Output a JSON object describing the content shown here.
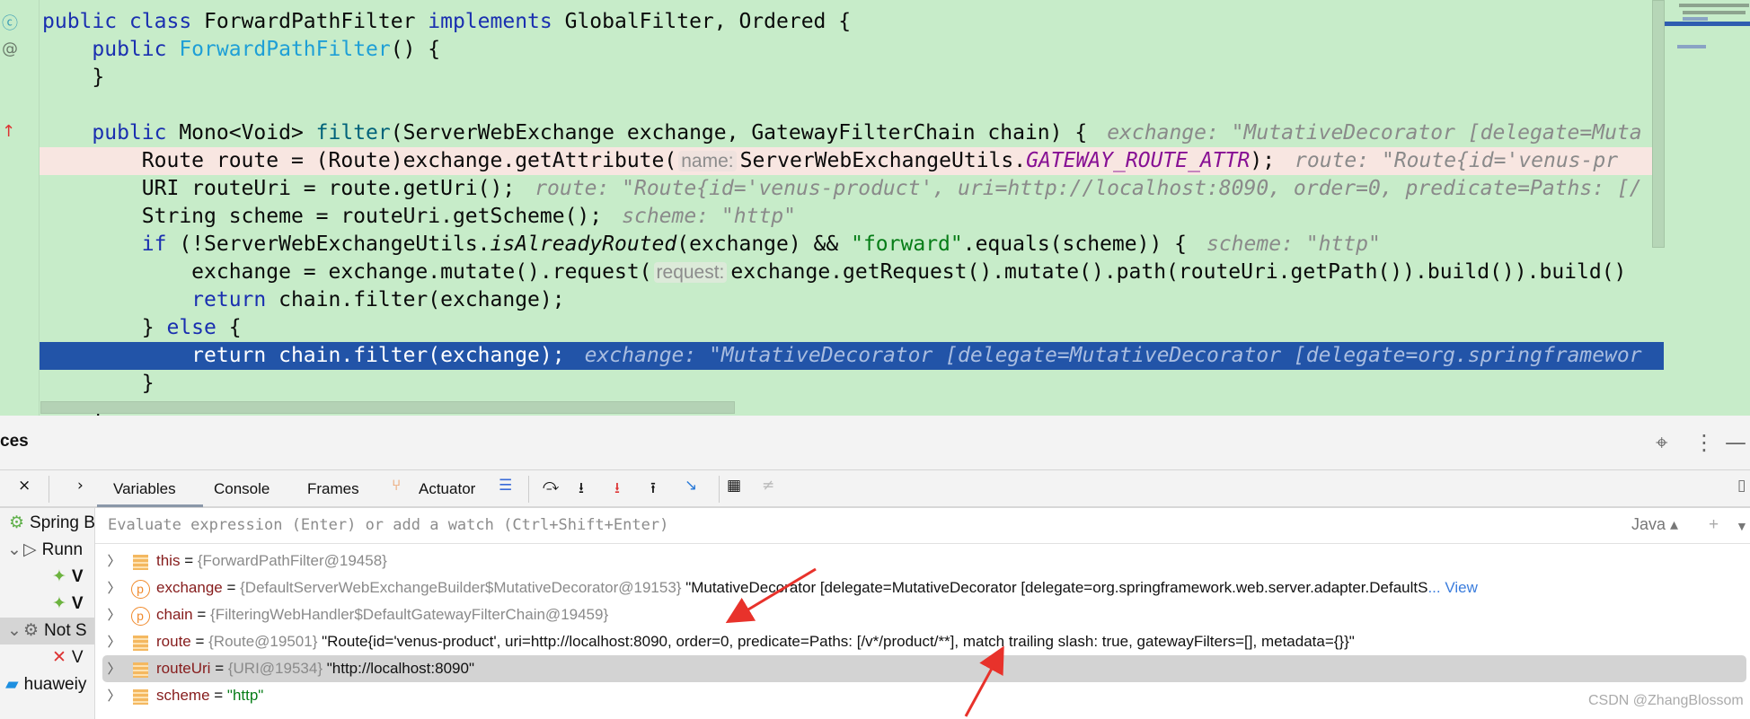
{
  "editor": {
    "lines": [
      {
        "kind": "",
        "tokens": [
          {
            "t": "public class ",
            "c": "kw"
          },
          {
            "t": "ForwardPathFilter "
          },
          {
            "t": "implements ",
            "c": "kw"
          },
          {
            "t": "GlobalFilter, Ordered {"
          }
        ]
      },
      {
        "kind": "",
        "tokens": [
          {
            "t": "    "
          },
          {
            "t": "public ",
            "c": "kw"
          },
          {
            "t": "ForwardPathFilter",
            "c": "ctor"
          },
          {
            "t": "() {"
          }
        ]
      },
      {
        "kind": "",
        "tokens": [
          {
            "t": "    }"
          }
        ]
      },
      {
        "kind": "",
        "tokens": [
          {
            "t": " "
          }
        ]
      },
      {
        "kind": "",
        "tokens": [
          {
            "t": "    "
          },
          {
            "t": "public ",
            "c": "kw"
          },
          {
            "t": "Mono<Void> "
          },
          {
            "t": "filter",
            "c": "fn"
          },
          {
            "t": "(ServerWebExchange exchange, GatewayFilterChain chain) {"
          },
          {
            "t": "exchange: \"MutativeDecorator [delegate=Muta",
            "c": "hint"
          }
        ]
      },
      {
        "kind": "bp",
        "tokens": [
          {
            "t": "        Route route = (Route)exchange.getAttribute("
          },
          {
            "t": "name:",
            "c": "inlay"
          },
          {
            "t": "ServerWebExchangeUtils."
          },
          {
            "t": "GATEWAY_ROUTE_ATTR",
            "c": "const"
          },
          {
            "t": ");"
          },
          {
            "t": "route: \"Route{id='venus-pr",
            "c": "hint"
          }
        ]
      },
      {
        "kind": "",
        "tokens": [
          {
            "t": "        URI routeUri = route.getUri();"
          },
          {
            "t": "route: \"Route{id='venus-product', uri=http://localhost:8090, order=0, predicate=Paths: [/",
            "c": "hint"
          }
        ]
      },
      {
        "kind": "",
        "tokens": [
          {
            "t": "        String scheme = routeUri.getScheme();"
          },
          {
            "t": "scheme: \"http\"",
            "c": "hint"
          }
        ]
      },
      {
        "kind": "",
        "tokens": [
          {
            "t": "        "
          },
          {
            "t": "if ",
            "c": "kw"
          },
          {
            "t": "(!ServerWebExchangeUtils."
          },
          {
            "t": "isAlreadyRouted",
            "c": "static"
          },
          {
            "t": "(exchange) && "
          },
          {
            "t": "\"forward\"",
            "c": "str"
          },
          {
            "t": ".equals(scheme)) {"
          },
          {
            "t": "scheme: \"http\"",
            "c": "hint"
          }
        ]
      },
      {
        "kind": "",
        "tokens": [
          {
            "t": "            exchange = exchange.mutate().request("
          },
          {
            "t": "request:",
            "c": "inlay"
          },
          {
            "t": "exchange.getRequest().mutate().path(routeUri.getPath()).build()).build()"
          }
        ]
      },
      {
        "kind": "",
        "tokens": [
          {
            "t": "            "
          },
          {
            "t": "return ",
            "c": "kw"
          },
          {
            "t": "chain.filter(exchange);"
          }
        ]
      },
      {
        "kind": "",
        "tokens": [
          {
            "t": "        } "
          },
          {
            "t": "else ",
            "c": "kw"
          },
          {
            "t": "{"
          }
        ]
      },
      {
        "kind": "exec",
        "tokens": [
          {
            "t": "            "
          },
          {
            "t": "return ",
            "c": "kw"
          },
          {
            "t": "chain.filter(exchange);"
          },
          {
            "t": "exchange: \"MutativeDecorator [delegate=MutativeDecorator [delegate=org.springframewor",
            "c": "hint"
          }
        ]
      },
      {
        "kind": "",
        "tokens": [
          {
            "t": "        }"
          }
        ]
      },
      {
        "kind": "",
        "tokens": [
          {
            "t": "    }"
          }
        ]
      }
    ]
  },
  "panel": {
    "title": "ces",
    "tabs": [
      {
        "label": "Variables",
        "active": true
      },
      {
        "label": "Console"
      },
      {
        "label": "Frames"
      },
      {
        "label": "Actuator"
      }
    ],
    "eval_placeholder": "Evaluate expression (Enter) or add a watch (Ctrl+Shift+Enter)",
    "language": "Java"
  },
  "tree": [
    {
      "label": "Spring B",
      "icon": "spring-boot-icon"
    },
    {
      "label": "Runn",
      "icon": "run-icon"
    },
    {
      "label": "V",
      "icon": "spring-debug-icon",
      "selected": true
    },
    {
      "label": "V",
      "icon": "spring-debug-icon"
    },
    {
      "label": "Not S",
      "icon": "gear-icon"
    },
    {
      "label": "V",
      "icon": "spring-stopped-icon"
    },
    {
      "label": "huaweiy",
      "icon": "docker-icon"
    }
  ],
  "variables": [
    {
      "name": "this",
      "icon": "field",
      "type": "{ForwardPathFilter@19458}",
      "value": ""
    },
    {
      "name": "exchange",
      "icon": "param",
      "type": "{DefaultServerWebExchangeBuilder$MutativeDecorator@19153}",
      "value": "\"MutativeDecorator [delegate=MutativeDecorator [delegate=org.springframework.web.server.adapter.DefaultS",
      "link": "... View"
    },
    {
      "name": "chain",
      "icon": "param",
      "type": "{FilteringWebHandler$DefaultGatewayFilterChain@19459}",
      "value": ""
    },
    {
      "name": "route",
      "icon": "field",
      "type": "{Route@19501}",
      "value": "\"Route{id='venus-product', uri=http://localhost:8090, order=0, predicate=Paths: [/v*/product/**], match trailing slash: true, gatewayFilters=[], metadata={}}\""
    },
    {
      "name": "routeUri",
      "icon": "field",
      "type": "{URI@19534}",
      "value": "\"http://localhost:8090\"",
      "highlight": true
    },
    {
      "name": "scheme",
      "icon": "field",
      "type": "",
      "value": "\"http\"",
      "string": true
    }
  ],
  "watermark": "CSDN @ZhangBlossom",
  "colors": {
    "editor_bg": "#c7ecc9",
    "exec_line": "#2254a8",
    "breakpoint_line": "#f8e6e1",
    "annotation_arrow": "#e8322b"
  }
}
